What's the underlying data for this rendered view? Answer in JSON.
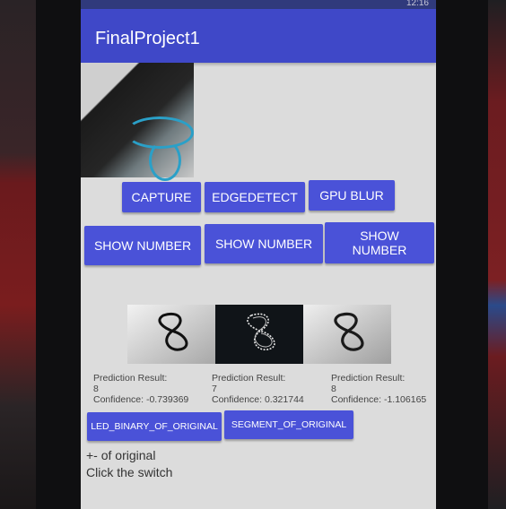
{
  "status_bar": {
    "clock": "12:16"
  },
  "app_bar": {
    "title": "FinalProject1"
  },
  "buttons_row1": [
    {
      "label": "CAPTURE"
    },
    {
      "label": "EDGEDETECT"
    },
    {
      "label": "GPU BLUR"
    }
  ],
  "buttons_row2": [
    {
      "label": "SHOW NUMBER"
    },
    {
      "label": "SHOW NUMBER"
    },
    {
      "label": "SHOW NUMBER"
    }
  ],
  "predictions": [
    {
      "title": "Prediction Result:",
      "digit": "8",
      "confidence": "Confidence: -0.739369"
    },
    {
      "title": "Prediction Result:",
      "digit": "7",
      "confidence": "Confidence: 0.321744"
    },
    {
      "title": "Prediction Result:",
      "digit": "8",
      "confidence": "Confidence: -1.106165"
    }
  ],
  "buttons_row3": [
    {
      "label": "LED_BINARY_OF_ORIGINAL"
    },
    {
      "label": "SEGMENT_OF_ORIGINAL"
    }
  ],
  "captions": {
    "line1": "+- of original",
    "line2": "Click the switch"
  },
  "colors": {
    "app_bar": "#3f48c8",
    "button": "#4a52d8",
    "screen_background": "#dcdcdc"
  }
}
